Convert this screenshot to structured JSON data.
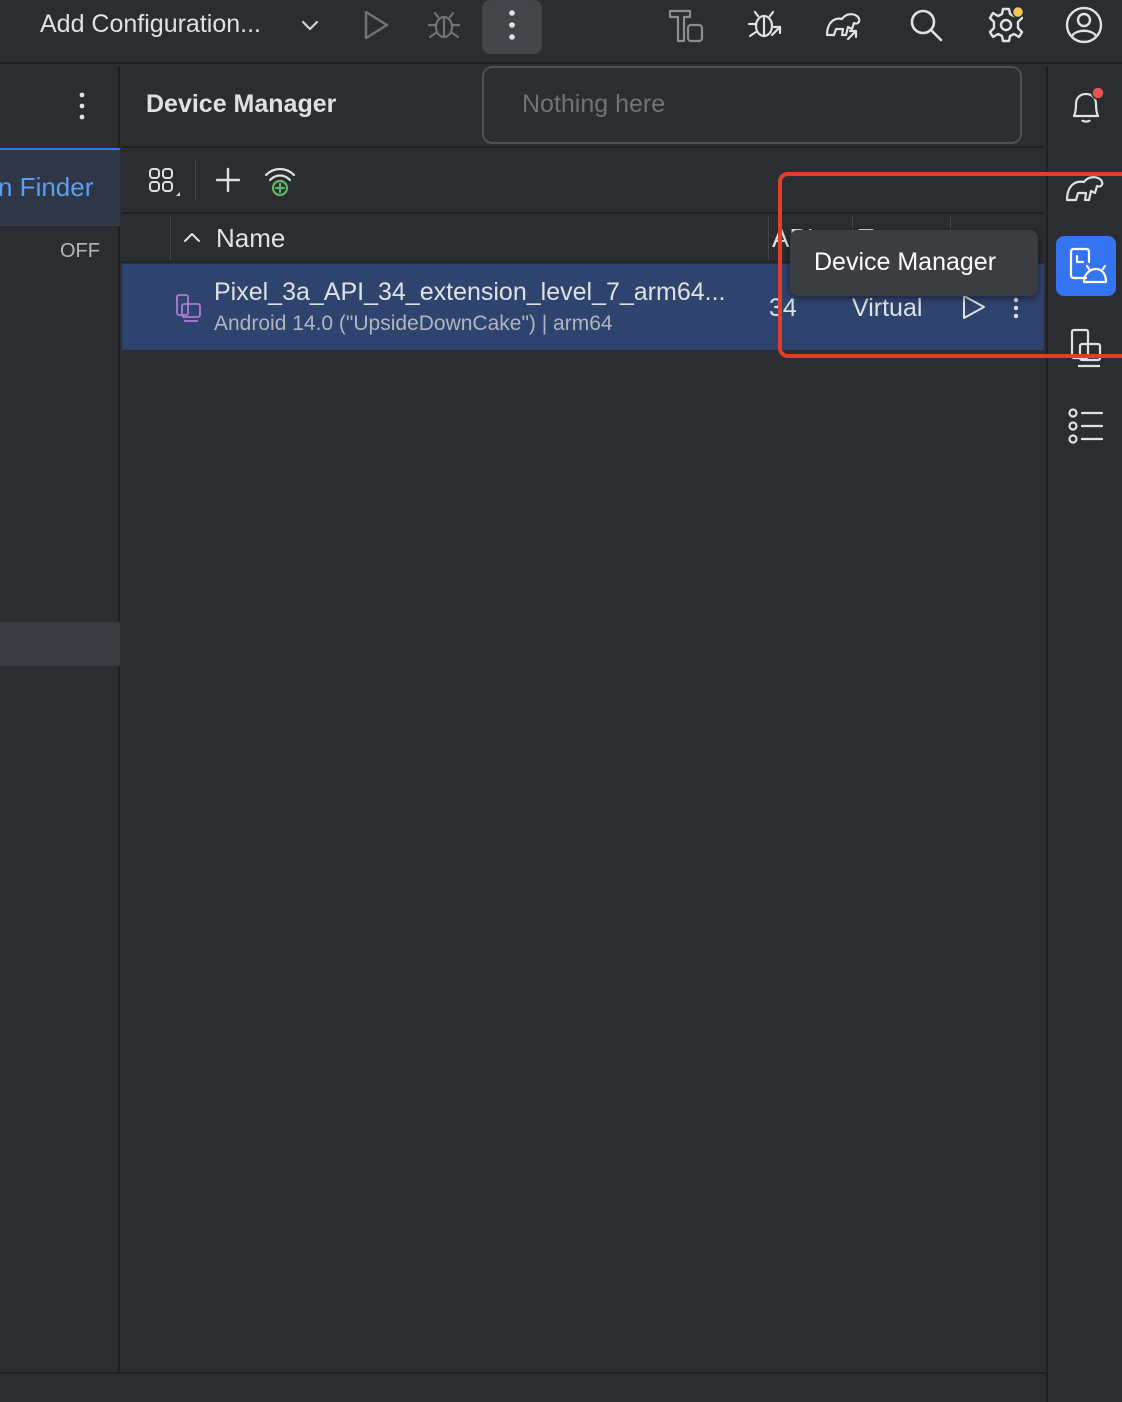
{
  "toolbar": {
    "config_label": "Add Configuration...",
    "icons": [
      "chevron-down-icon",
      "run-icon",
      "debug-icon",
      "more-vertical-icon",
      "build-icon",
      "debug-attach-icon",
      "gradle-sync-icon",
      "search-icon",
      "settings-icon",
      "account-icon"
    ]
  },
  "left_panel": {
    "finder_label": "n Finder",
    "off_label": "OFF"
  },
  "device_manager": {
    "title": "Device Manager",
    "toolbar_icons": [
      "device-group-icon",
      "add-icon",
      "pair-wifi-icon"
    ],
    "columns": {
      "name": "Name",
      "api": "API",
      "type": "Type"
    },
    "devices": [
      {
        "name": "Pixel_3a_API_34_extension_level_7_arm64...",
        "description": "Android 14.0 (\"UpsideDownCake\") | arm64",
        "api": "34",
        "type": "Virtual"
      }
    ]
  },
  "popup": {
    "text": "Nothing here"
  },
  "tooltip": {
    "text": "Device Manager"
  },
  "right_strip": {
    "icons": [
      "notifications-icon",
      "gradle-icon",
      "device-manager-icon",
      "running-devices-icon",
      "structure-icon"
    ]
  },
  "colors": {
    "accent": "#3574f0",
    "highlight": "#e0402a",
    "selection": "#2e436e",
    "notification_dot": "#e55353",
    "settings_dot": "#f2c55c"
  }
}
